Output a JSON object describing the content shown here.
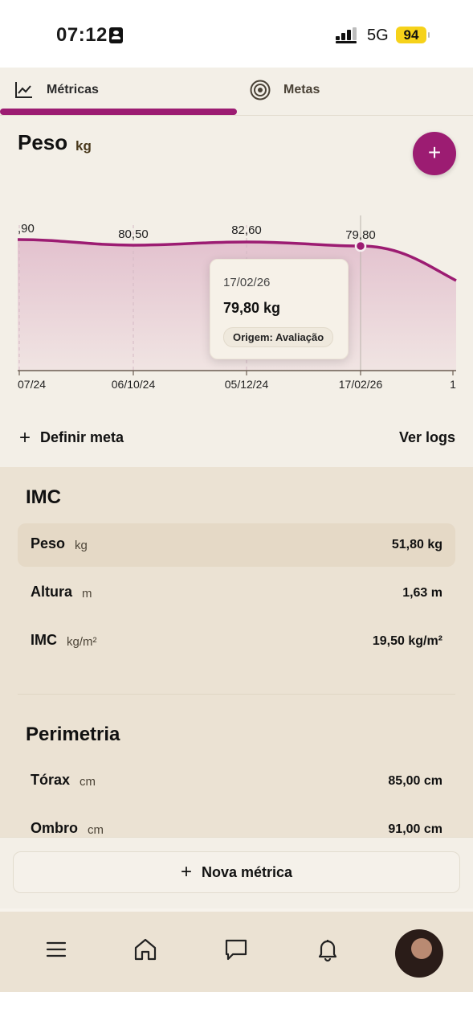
{
  "status_bar": {
    "time": "07:12",
    "network": "5G",
    "battery": "94"
  },
  "tabs": [
    {
      "label": "Métricas",
      "icon": "line-chart-icon",
      "active": true
    },
    {
      "label": "Metas",
      "icon": "target-icon",
      "active": false
    }
  ],
  "section": {
    "title": "Peso",
    "unit": "kg",
    "add_label": "+"
  },
  "chart_data": {
    "type": "area",
    "x": [
      "…/07/24",
      "06/10/24",
      "05/12/24",
      "17/02/26",
      "1…"
    ],
    "points": [
      {
        "date": "…/07/24",
        "value": 80.9,
        "label": ",90"
      },
      {
        "date": "06/10/24",
        "value": 80.5,
        "label": "80,50"
      },
      {
        "date": "05/12/24",
        "value": 82.6,
        "label": "82,60"
      },
      {
        "date": "17/02/26",
        "value": 79.8,
        "label": "79,80"
      }
    ],
    "tick_labels": [
      "07/24",
      "06/10/24",
      "05/12/24",
      "17/02/26",
      "1"
    ],
    "line_color": "#9c1c72",
    "fill_color": "#e6c9d3",
    "selected": "17/02/26"
  },
  "tooltip": {
    "date": "17/02/26",
    "value": "79,80 kg",
    "origin": "Origem: Avaliação"
  },
  "actions": {
    "define_goal": "Definir meta",
    "view_logs": "Ver logs"
  },
  "imc": {
    "title": "IMC",
    "rows": [
      {
        "name": "Peso",
        "unit": "kg",
        "value": "51,80 kg"
      },
      {
        "name": "Altura",
        "unit": "m",
        "value": "1,63 m"
      },
      {
        "name": "IMC",
        "unit": "kg/m²",
        "value": "19,50 kg/m²"
      }
    ]
  },
  "perimetria": {
    "title": "Perimetria",
    "rows": [
      {
        "name": "Tórax",
        "unit": "cm",
        "value": "85,00 cm"
      },
      {
        "name": "Ombro",
        "unit": "cm",
        "value": "91,00 cm"
      }
    ]
  },
  "new_metric": {
    "label": "Nova métrica"
  },
  "bottom_nav": [
    {
      "icon": "menu-icon"
    },
    {
      "icon": "home-icon"
    },
    {
      "icon": "chat-icon"
    },
    {
      "icon": "bell-icon"
    },
    {
      "icon": "avatar"
    }
  ]
}
